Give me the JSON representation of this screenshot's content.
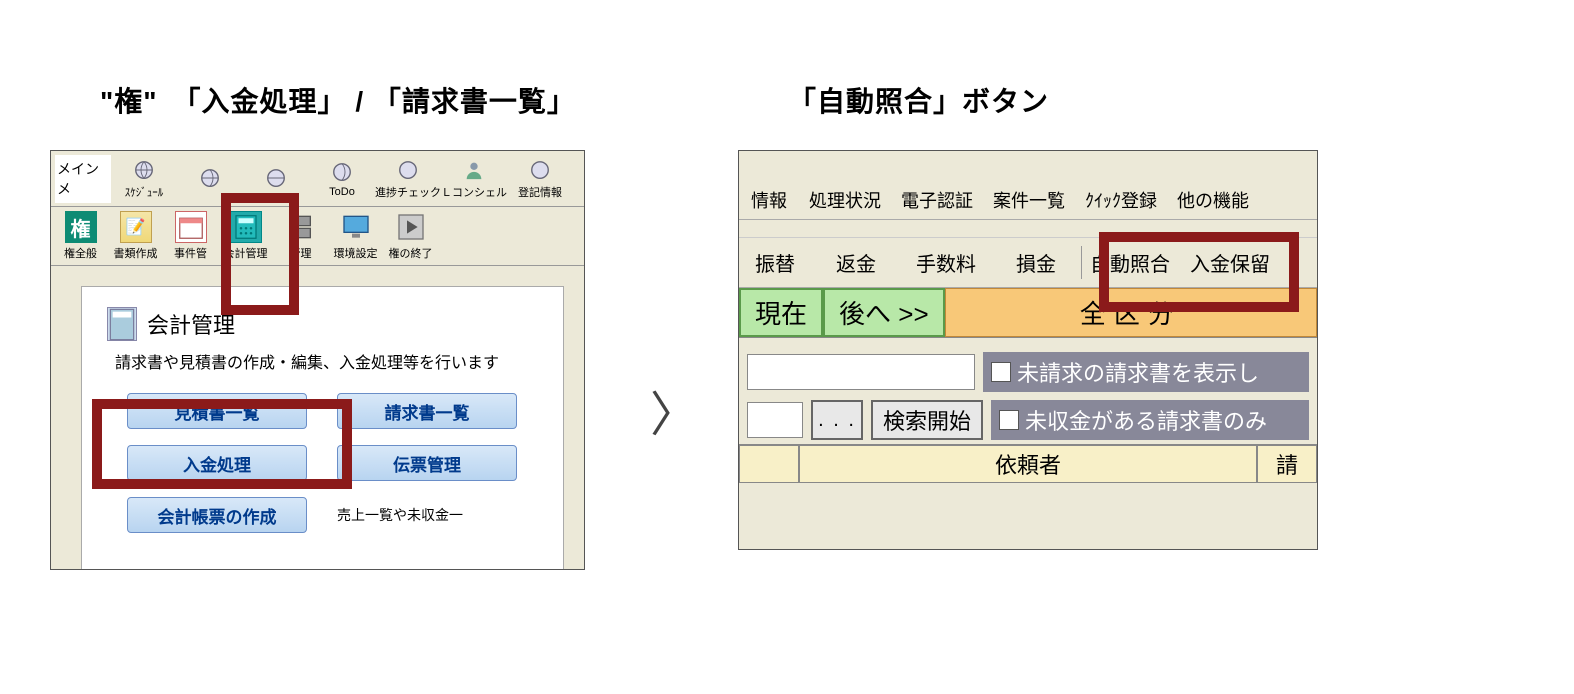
{
  "headings": {
    "left": "\"権\"　「入金処理」 / 「請求書一覧」",
    "right": "「自動照合」ボタン"
  },
  "leftPanel": {
    "mainMenuLabel": "メインメ",
    "toolbar1": {
      "schedule": "ｽｹｼﾞｭｰﾙ",
      "todo": "ToDo",
      "progress": "進捗チェック",
      "lconcierge": "Ｌコンシェル",
      "touki": "登記情報"
    },
    "toolbar2": {
      "kenzen": "権全般",
      "shorui": "書類作成",
      "jiken": "事件管",
      "kaikei": "会計管理",
      "kanri": "管理",
      "kankyou": "環境設定",
      "kenend": "権の終了"
    },
    "section": {
      "title": "会計管理",
      "desc": "請求書や見積書の作成・編集、入金処理等を行います",
      "btn_mitsumori": "見積書一覧",
      "btn_seikyuu": "請求書一覧",
      "btn_nyuukin": "入金処理",
      "btn_denpyou": "伝票管理",
      "btn_kaikei": "会計帳票の作成",
      "side_uriage": "売上一覧や未収金一"
    }
  },
  "rightPanel": {
    "toolbar": {
      "jouhou": "情報",
      "shori": "処理状況",
      "denshi": "電子認証",
      "anken": "案件一覧",
      "quick": "ｸｲｯｸ登録",
      "hoka": "他の機能"
    },
    "actions": {
      "furikae": "振替",
      "henkin": "返金",
      "tesuu": "手数料",
      "sonkin": "損金",
      "jidou": "自動照合",
      "nyuukin": "入金保留"
    },
    "nav": {
      "genzai": "現在",
      "atohe": "後へ >>",
      "kubun": "全区分"
    },
    "filter": {
      "dots": ". . .",
      "kensaku": "検索開始",
      "chk1": "未請求の請求書を表示し",
      "chk2": "未収金がある請求書のみ"
    },
    "headers": {
      "irai": "依頼者",
      "sei": "請"
    }
  }
}
